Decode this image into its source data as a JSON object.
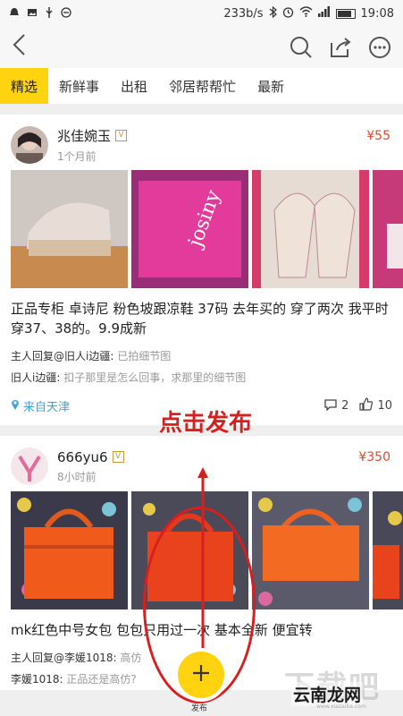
{
  "status_bar": {
    "speed": "233b/s",
    "time": "19:08",
    "left_icons": [
      "notification-icon",
      "image-icon",
      "usb-icon",
      "minus-circle-icon"
    ],
    "right_icons": [
      "bluetooth-icon",
      "alarm-icon",
      "wifi-icon",
      "signal-icon",
      "battery-icon"
    ]
  },
  "navbar": {
    "back_icon": "back-icon",
    "actions": [
      "search-icon",
      "share-icon",
      "more-icon"
    ]
  },
  "tabs": [
    {
      "label": "精选",
      "active": true
    },
    {
      "label": "新鲜事",
      "active": false
    },
    {
      "label": "出租",
      "active": false
    },
    {
      "label": "邻居帮帮忙",
      "active": false
    },
    {
      "label": "最新",
      "active": false
    }
  ],
  "posts": [
    {
      "user": "兆佳婉玉",
      "badge": "V",
      "time": "1个月前",
      "price": "¥55",
      "description": "正品专柜 卓诗尼 粉色坡跟凉鞋 37码 去年买的 穿了两次 我平时穿37、38的。9.9成新",
      "replies": [
        {
          "name": "主人回复@旧人i边疆:",
          "text": "已拍细节图"
        },
        {
          "name": "旧人i边疆:",
          "text": "扣子那里是怎么回事，求那里的细节图"
        }
      ],
      "location": "来自天津",
      "comments": "2",
      "likes": "10"
    },
    {
      "user": "666yu6",
      "badge": "V",
      "time": "8小时前",
      "price": "¥350",
      "description": "mk红色中号女包 包包只用过一次 基本全新 便宜转",
      "replies": [
        {
          "name": "主人回复@李媛1018:",
          "text": "高仿"
        },
        {
          "name": "李媛1018:",
          "text": "正品还是高仿?"
        }
      ]
    }
  ],
  "annotation": "点击发布",
  "fab": {
    "icon": "plus-icon",
    "label": "发布"
  },
  "watermark": {
    "big": "下载吧",
    "small": "云南龙网",
    "url": "www.xiazaiba.com"
  },
  "colors": {
    "accent": "#ffd30f",
    "price": "#e24a2f",
    "location": "#3fa3d6",
    "annotation": "#d81f1f"
  }
}
